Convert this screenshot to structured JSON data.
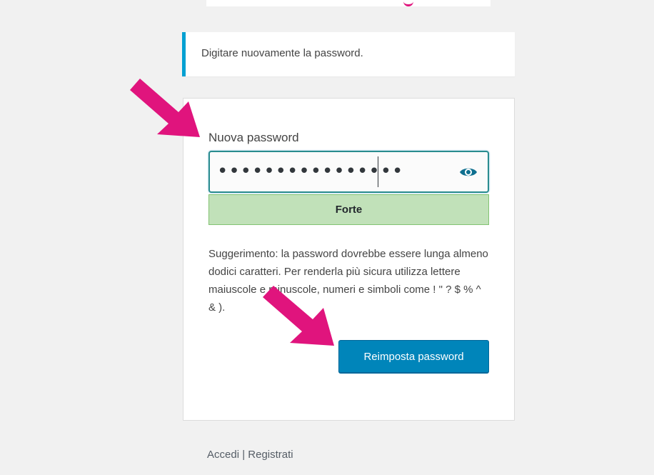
{
  "message": {
    "text": "Digitare nuovamente la password."
  },
  "form": {
    "password_label": "Nuova password",
    "password_value": "••••••••••••••••",
    "strength_label": "Forte",
    "hint": "Suggerimento: la password dovrebbe essere lunga almeno dodici caratteri. Per renderla più sicura utilizza lettere maiuscole e minuscole, numeri e simboli come ! \" ? $ % ^ & ).",
    "submit_label": "Reimposta password"
  },
  "nav": {
    "login": "Accedi",
    "separator": " | ",
    "register": "Registrati"
  },
  "colors": {
    "accent": "#0085ba",
    "notice_border": "#00a0d2",
    "strength_bg": "#c1e1b9",
    "annotation_arrow": "#e0147d"
  },
  "icons": {
    "show_password": "eye-icon",
    "annotation": "arrow-annotation"
  }
}
